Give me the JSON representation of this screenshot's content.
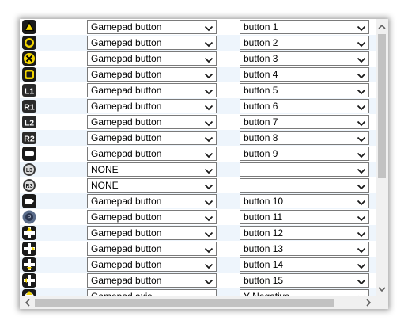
{
  "rows": [
    {
      "icon": "triangle-icon",
      "mapping": "Gamepad button",
      "target": "button 1"
    },
    {
      "icon": "circle-icon",
      "mapping": "Gamepad button",
      "target": "button 2"
    },
    {
      "icon": "cross-icon",
      "mapping": "Gamepad button",
      "target": "button 3"
    },
    {
      "icon": "square-icon",
      "mapping": "Gamepad button",
      "target": "button 4"
    },
    {
      "icon": "l1-icon",
      "mapping": "Gamepad button",
      "target": "button 5",
      "label": "L1"
    },
    {
      "icon": "r1-icon",
      "mapping": "Gamepad button",
      "target": "button 6",
      "label": "R1"
    },
    {
      "icon": "l2-icon",
      "mapping": "Gamepad button",
      "target": "button 7",
      "label": "L2"
    },
    {
      "icon": "r2-icon",
      "mapping": "Gamepad button",
      "target": "button 8",
      "label": "R2"
    },
    {
      "icon": "select-icon",
      "mapping": "Gamepad button",
      "target": "button 9"
    },
    {
      "icon": "l3-icon",
      "mapping": "NONE",
      "target": "",
      "label": "L3"
    },
    {
      "icon": "r3-icon",
      "mapping": "NONE",
      "target": "",
      "label": "R3"
    },
    {
      "icon": "start-icon",
      "mapping": "Gamepad button",
      "target": "button 10"
    },
    {
      "icon": "ps-button-icon",
      "mapping": "Gamepad button",
      "target": "button 11"
    },
    {
      "icon": "dpad-up-icon",
      "mapping": "Gamepad button",
      "target": "button 12"
    },
    {
      "icon": "dpad-right-icon",
      "mapping": "Gamepad button",
      "target": "button 13"
    },
    {
      "icon": "dpad-down-icon",
      "mapping": "Gamepad button",
      "target": "button 14"
    },
    {
      "icon": "dpad-left-icon",
      "mapping": "Gamepad button",
      "target": "button 15"
    },
    {
      "icon": "left-stick-up-icon",
      "mapping": "Gamepad axis",
      "target": "Y Negative"
    }
  ],
  "scroll": {
    "vertical_position": 0.0,
    "horizontal_position": 0.0
  }
}
